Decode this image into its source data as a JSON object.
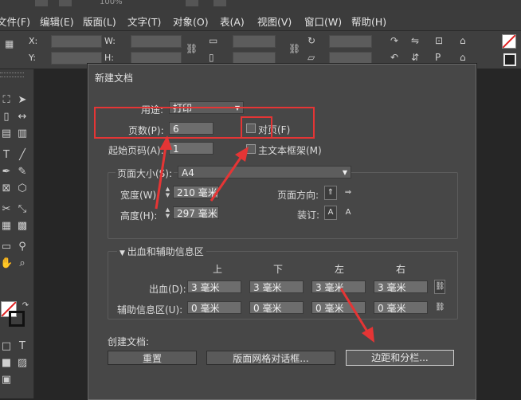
{
  "menu": {
    "items": [
      "文件(F)",
      "编辑(E)",
      "版面(L)",
      "文字(T)",
      "对象(O)",
      "表(A)",
      "视图(V)",
      "窗口(W)",
      "帮助(H)"
    ],
    "zoom": "100%"
  },
  "control_bar": {
    "x_label": "X:",
    "y_label": "Y:",
    "w_label": "W:",
    "h_label": "H:"
  },
  "dialog": {
    "title": "新建文档",
    "intent_label": "用途:",
    "intent_value": "打印",
    "pages_label": "页数(P):",
    "pages_value": "6",
    "facing_label": "对页(F)",
    "start_page_label": "起始页码(A):",
    "start_page_value": "1",
    "primary_frame_label": "主文本框架(M)",
    "page_size_label": "页面大小(S):",
    "page_size_value": "A4",
    "width_label": "宽度(W):",
    "width_value": "210 毫米",
    "height_label": "高度(H):",
    "height_value": "297 毫米",
    "orientation_label": "页面方向:",
    "binding_label": "装订:",
    "bleed_section_title": "出血和辅助信息区",
    "col_headers": [
      "上",
      "下",
      "左",
      "右"
    ],
    "bleed_label": "出血(D):",
    "bleed_values": [
      "3 毫米",
      "3 毫米",
      "3 毫米",
      "3 毫米"
    ],
    "slug_label": "辅助信息区(U):",
    "slug_values": [
      "0 毫米",
      "0 毫米",
      "0 毫米",
      "0 毫米"
    ],
    "create_label": "创建文档:",
    "btn_reset": "重置",
    "btn_grid": "版面网格对话框...",
    "btn_margins": "边距和分栏..."
  }
}
